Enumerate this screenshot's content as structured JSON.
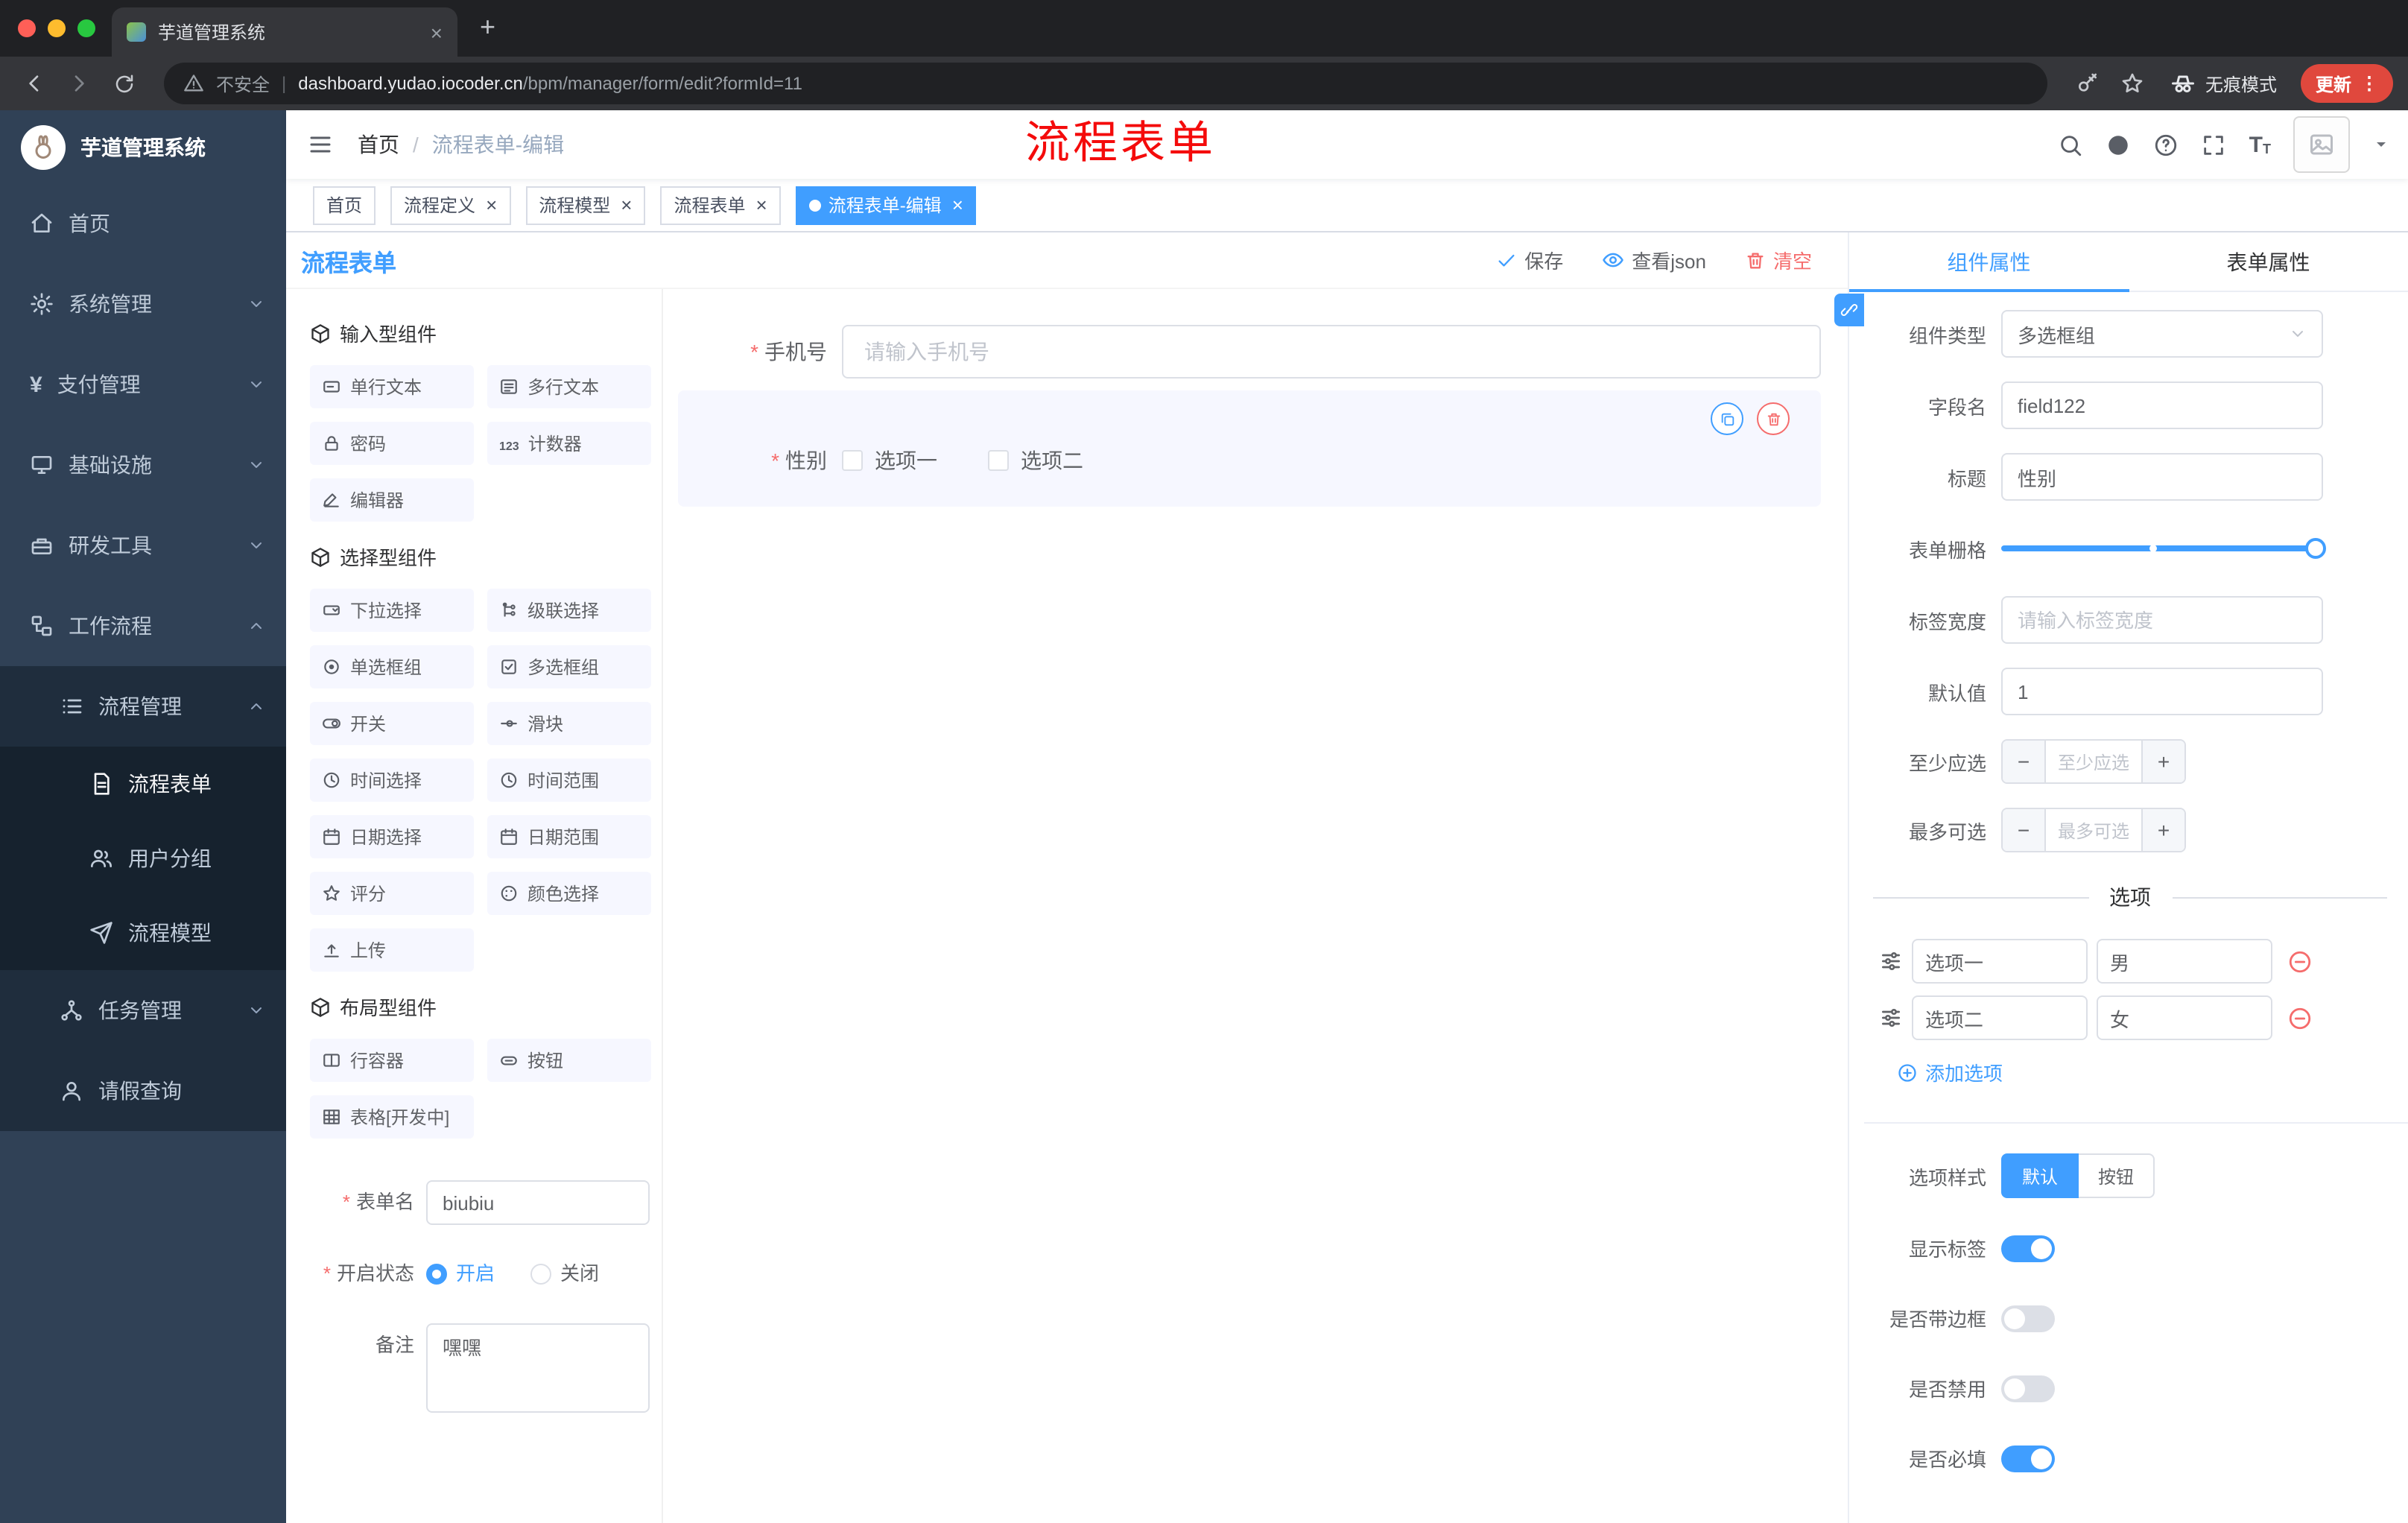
{
  "colors": {
    "accent": "#409EFF",
    "danger": "#F56C6C",
    "sidebar_bg": "#304156",
    "update_button_red": "#E0483D",
    "annotation_red": "#F40B0B"
  },
  "browser": {
    "tab_title": "芋道管理系统",
    "security_label": "不安全",
    "url_divider": "|",
    "url_host": "dashboard.yudao.iocoder.cn",
    "url_path": "/bpm/manager/form/edit?formId=11",
    "incognito_label": "无痕模式",
    "update_label": "更新"
  },
  "header": {
    "breadcrumb_home": "首页",
    "breadcrumb_current": "流程表单-编辑",
    "annotation": "流程表单"
  },
  "tags": [
    {
      "label": "首页",
      "closable": false,
      "active": false
    },
    {
      "label": "流程定义",
      "closable": true,
      "active": false
    },
    {
      "label": "流程模型",
      "closable": true,
      "active": false
    },
    {
      "label": "流程表单",
      "closable": true,
      "active": false
    },
    {
      "label": "流程表单-编辑",
      "closable": true,
      "active": true
    }
  ],
  "sidebar": {
    "brand": "芋道管理系统",
    "menu": [
      {
        "label": "首页",
        "icon": "dashboard",
        "level": 1
      },
      {
        "label": "系统管理",
        "icon": "gear",
        "level": 1,
        "expandable": true
      },
      {
        "label": "支付管理",
        "icon": "yen",
        "level": 1,
        "expandable": true
      },
      {
        "label": "基础设施",
        "icon": "monitor",
        "level": 1,
        "expandable": true
      },
      {
        "label": "研发工具",
        "icon": "toolbox",
        "level": 1,
        "expandable": true
      },
      {
        "label": "工作流程",
        "icon": "workflow",
        "level": 1,
        "expandable": true,
        "expanded": true
      },
      {
        "label": "流程管理",
        "icon": "list",
        "level": 2,
        "expandable": true,
        "expanded": true
      },
      {
        "label": "流程表单",
        "icon": "document",
        "level": 3,
        "active": true
      },
      {
        "label": "用户分组",
        "icon": "users",
        "level": 3
      },
      {
        "label": "流程模型",
        "icon": "send",
        "level": 3
      },
      {
        "label": "任务管理",
        "icon": "tree",
        "level": 2,
        "expandable": true
      },
      {
        "label": "请假查询",
        "icon": "person",
        "level": 2
      }
    ]
  },
  "builder": {
    "panel_title": "流程表单",
    "save_label": "保存",
    "view_json_label": "查看json",
    "clear_label": "清空",
    "groups": [
      {
        "title": "输入型组件",
        "items": [
          {
            "label": "单行文本",
            "icon": "single-line-text"
          },
          {
            "label": "多行文本",
            "icon": "multi-line-text"
          },
          {
            "label": "密码",
            "icon": "password-lock"
          },
          {
            "label": "计数器",
            "icon": "counter-123"
          },
          {
            "label": "编辑器",
            "icon": "rich-editor"
          }
        ]
      },
      {
        "title": "选择型组件",
        "items": [
          {
            "label": "下拉选择",
            "icon": "select-dropdown"
          },
          {
            "label": "级联选择",
            "icon": "cascader"
          },
          {
            "label": "单选框组",
            "icon": "radio-group"
          },
          {
            "label": "多选框组",
            "icon": "checkbox-group"
          },
          {
            "label": "开关",
            "icon": "switch"
          },
          {
            "label": "滑块",
            "icon": "slider"
          },
          {
            "label": "时间选择",
            "icon": "time-picker"
          },
          {
            "label": "时间范围",
            "icon": "time-range"
          },
          {
            "label": "日期选择",
            "icon": "date-picker"
          },
          {
            "label": "日期范围",
            "icon": "date-range"
          },
          {
            "label": "评分",
            "icon": "rate-star"
          },
          {
            "label": "颜色选择",
            "icon": "color-picker"
          },
          {
            "label": "上传",
            "icon": "upload"
          }
        ]
      },
      {
        "title": "布局型组件",
        "items": [
          {
            "label": "行容器",
            "icon": "row-container"
          },
          {
            "label": "按钮",
            "icon": "button"
          },
          {
            "label": "表格[开发中]",
            "icon": "table"
          }
        ]
      }
    ],
    "meta": {
      "name_label": "表单名",
      "name_value": "biubiu",
      "status_label": "开启状态",
      "status_on": "开启",
      "status_off": "关闭",
      "status_selected": "开启",
      "remark_label": "备注",
      "remark_value": "嘿嘿"
    },
    "canvas": {
      "phone_label": "手机号",
      "phone_placeholder": "请输入手机号",
      "gender_label": "性别",
      "gender_option1": "选项一",
      "gender_option2": "选项二"
    }
  },
  "props": {
    "tab_component": "组件属性",
    "tab_form": "表单属性",
    "active_tab": "组件属性",
    "type_label": "组件类型",
    "type_value": "多选框组",
    "field_label": "字段名",
    "field_value": "field122",
    "title_label": "标题",
    "title_value": "性别",
    "grid_label": "表单栅格",
    "labelw_label": "标签宽度",
    "labelw_placeholder": "请输入标签宽度",
    "default_label": "默认值",
    "default_value": "1",
    "min_label": "至少应选",
    "min_placeholder": "至少应选",
    "max_label": "最多可选",
    "max_placeholder": "最多可选",
    "options_divider": "选项",
    "options": [
      {
        "label": "选项一",
        "value": "男"
      },
      {
        "label": "选项二",
        "value": "女"
      }
    ],
    "add_option": "添加选项",
    "style_label": "选项样式",
    "style_default": "默认",
    "style_button": "按钮",
    "style_selected": "默认",
    "switches": [
      {
        "label": "显示标签",
        "on": true
      },
      {
        "label": "是否带边框",
        "on": false
      },
      {
        "label": "是否禁用",
        "on": false
      },
      {
        "label": "是否必填",
        "on": true
      }
    ]
  }
}
